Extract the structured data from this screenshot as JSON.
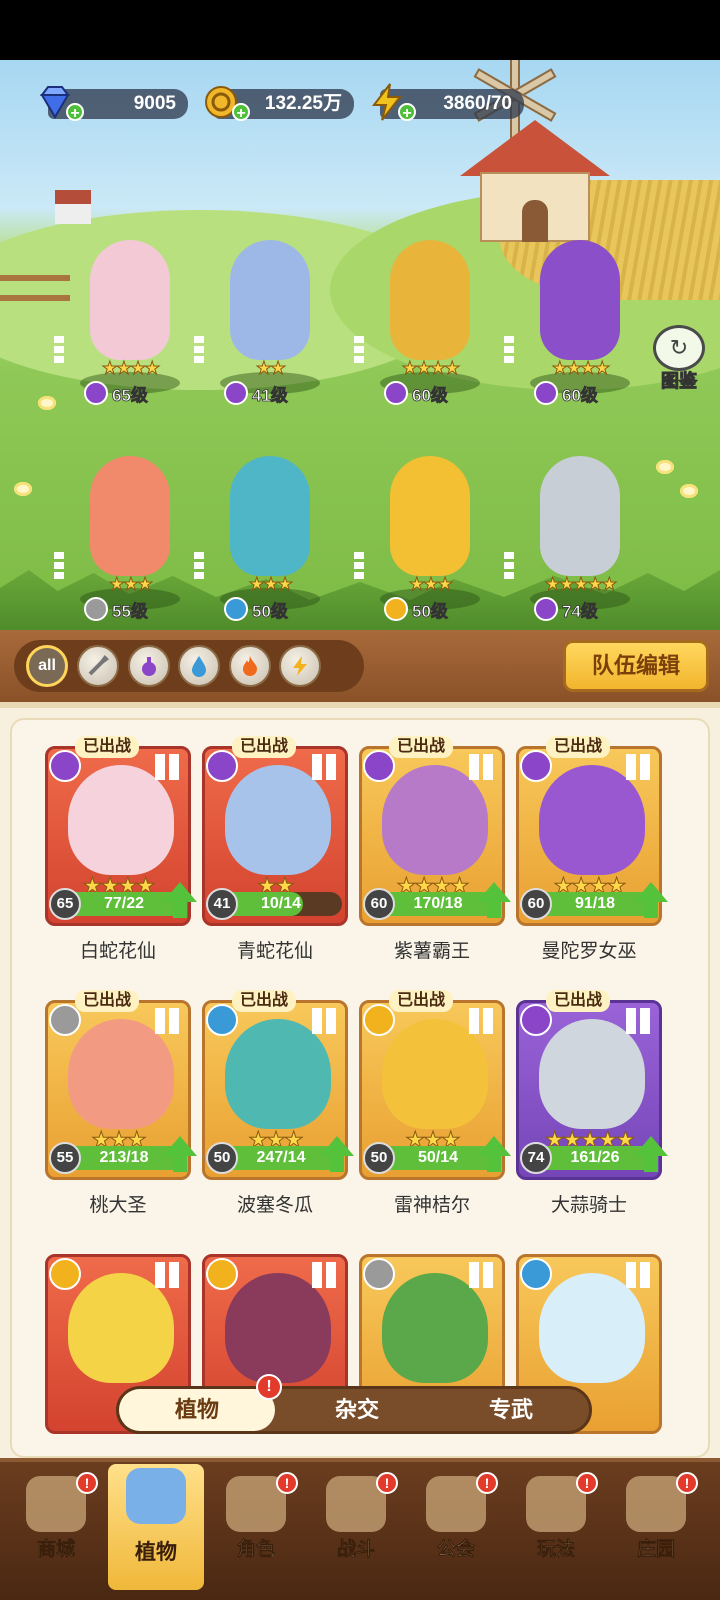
{
  "resources": [
    {
      "name": "diamond-icon",
      "value": "9005",
      "color": "#3f6ee8"
    },
    {
      "name": "coin-icon",
      "value": "132.25万",
      "color": "#f0b72a"
    },
    {
      "name": "energy-icon",
      "value": "3860/70",
      "color": "#f0c21e"
    }
  ],
  "handbook": {
    "label": "图鉴"
  },
  "field": [
    {
      "stars": "★★★★",
      "level": "65级",
      "element": "potion",
      "color": "#f3c9d6"
    },
    {
      "stars": "★★",
      "level": "41级",
      "element": "potion",
      "color": "#9db8e6"
    },
    {
      "stars": "★★★★",
      "level": "60级",
      "element": "potion",
      "color": "#e8b43a"
    },
    {
      "stars": "★★★★",
      "level": "60级",
      "element": "potion",
      "color": "#8b4fc9"
    },
    {
      "stars": "★★★",
      "level": "55级",
      "element": "sword",
      "color": "#f08a6a"
    },
    {
      "stars": "★★★",
      "level": "50级",
      "element": "water",
      "color": "#4fb6c8"
    },
    {
      "stars": "★★★",
      "level": "50级",
      "element": "lightning",
      "color": "#f2c032"
    },
    {
      "stars": "★★★★★",
      "level": "74级",
      "element": "potion",
      "color": "#c7ced6"
    }
  ],
  "filters": {
    "all_label": "all",
    "team_edit": "队伍编辑"
  },
  "cards": [
    {
      "tag": "已出战",
      "name": "白蛇花仙",
      "level": "65",
      "progress": "77/22",
      "fill": 1.0,
      "stars": "★★★★",
      "frame": "red",
      "element_color": "#8a45c8",
      "art_color": "#f6d3dc",
      "upgrade": true
    },
    {
      "tag": "已出战",
      "name": "青蛇花仙",
      "level": "41",
      "progress": "10/14",
      "fill": 0.71,
      "stars": "★★",
      "frame": "red",
      "element_color": "#8a45c8",
      "art_color": "#a8c3ea",
      "upgrade": false
    },
    {
      "tag": "已出战",
      "name": "紫薯霸王",
      "level": "60",
      "progress": "170/18",
      "fill": 1.0,
      "stars": "★★★★",
      "frame": "gold",
      "element_color": "#8a45c8",
      "art_color": "#b77ac9",
      "upgrade": true
    },
    {
      "tag": "已出战",
      "name": "曼陀罗女巫",
      "level": "60",
      "progress": "91/18",
      "fill": 1.0,
      "stars": "★★★★",
      "frame": "gold",
      "element_color": "#8a45c8",
      "art_color": "#9a58d0",
      "upgrade": true
    },
    {
      "tag": "已出战",
      "name": "桃大圣",
      "level": "55",
      "progress": "213/18",
      "fill": 1.0,
      "stars": "★★★",
      "frame": "gold",
      "element_color": "#9a9a9a",
      "art_color": "#f39a82",
      "upgrade": true
    },
    {
      "tag": "已出战",
      "name": "波塞冬瓜",
      "level": "50",
      "progress": "247/14",
      "fill": 1.0,
      "stars": "★★★",
      "frame": "gold",
      "element_color": "#3a9ad8",
      "art_color": "#4fb8b0",
      "upgrade": true
    },
    {
      "tag": "已出战",
      "name": "雷神桔尔",
      "level": "50",
      "progress": "50/14",
      "fill": 1.0,
      "stars": "★★★",
      "frame": "gold",
      "element_color": "#f2b21e",
      "art_color": "#f3c23a",
      "upgrade": true
    },
    {
      "tag": "已出战",
      "name": "大蒜骑士",
      "level": "74",
      "progress": "161/26",
      "fill": 1.0,
      "stars": "★★★★★",
      "frame": "purple",
      "element_color": "#8a45c8",
      "art_color": "#cfd6de",
      "upgrade": true
    },
    {
      "tag": "",
      "name": "",
      "level": "",
      "progress": "",
      "fill": 0,
      "stars": "",
      "frame": "red",
      "element_color": "#f2b21e",
      "art_color": "#f4d347",
      "upgrade": false
    },
    {
      "tag": "",
      "name": "",
      "level": "",
      "progress": "",
      "fill": 0,
      "stars": "",
      "frame": "red",
      "element_color": "#f2b21e",
      "art_color": "#8a3a5a",
      "upgrade": false
    },
    {
      "tag": "",
      "name": "",
      "level": "",
      "progress": "",
      "fill": 0,
      "stars": "",
      "frame": "gold",
      "element_color": "#9a9a9a",
      "art_color": "#5aa84a",
      "upgrade": false
    },
    {
      "tag": "",
      "name": "",
      "level": "",
      "progress": "",
      "fill": 0,
      "stars": "",
      "frame": "gold",
      "element_color": "#3a9ad8",
      "art_color": "#d8eef8",
      "upgrade": false
    }
  ],
  "segment": {
    "tabs": [
      "植物",
      "杂交",
      "专武"
    ],
    "badge": "!"
  },
  "nav": [
    {
      "label": "商城",
      "badge": "!"
    },
    {
      "label": "植物",
      "badge": ""
    },
    {
      "label": "角色",
      "badge": "!"
    },
    {
      "label": "战斗",
      "badge": "!"
    },
    {
      "label": "公会",
      "badge": "!"
    },
    {
      "label": "玩法",
      "badge": "!"
    },
    {
      "label": "庄园",
      "badge": "!"
    }
  ]
}
